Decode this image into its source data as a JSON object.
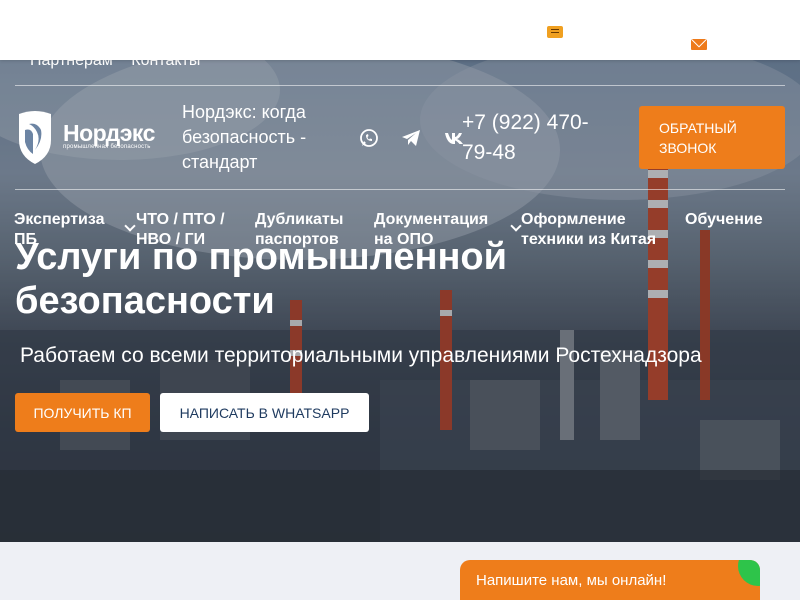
{
  "header": {
    "top_links": [
      "Партнерам",
      "Контакты"
    ],
    "logo": {
      "name": "Нордэкс",
      "tagline": "промышленная безопасность"
    },
    "slogan": "Нордэкс: когда безопасность - стандарт",
    "phone": "+7 (922) 470-79-48",
    "callback_label": "ОБРАТНЫЙ ЗВОНОК",
    "socials": [
      "whatsapp-icon",
      "telegram-icon",
      "vk-icon"
    ]
  },
  "nav": {
    "items": [
      {
        "label": "Экспертиза ПБ",
        "has_dropdown": true
      },
      {
        "label": "ЧТО / ПТО / НВО / ГИ",
        "has_dropdown": false
      },
      {
        "label": "Дубликаты паспортов",
        "has_dropdown": false
      },
      {
        "label": "Документация на ОПО",
        "has_dropdown": true
      },
      {
        "label": "Оформление техники из Китая",
        "has_dropdown": false
      },
      {
        "label": "Обучение",
        "has_dropdown": false
      }
    ]
  },
  "hero": {
    "title": "Услуги по промышленной безопасности",
    "subtitle": "Работаем со всеми территориальными управлениями Ростехнадзора",
    "btn_primary": "ПОЛУЧИТЬ КП",
    "btn_secondary": "НАПИСАТЬ В WHATSAPP"
  },
  "chat_widget": {
    "label": "Напишите нам, мы онлайн!"
  },
  "colors": {
    "accent": "#ee7d1b",
    "secondary_text": "#1e3a5f",
    "online": "#2ec44a"
  }
}
